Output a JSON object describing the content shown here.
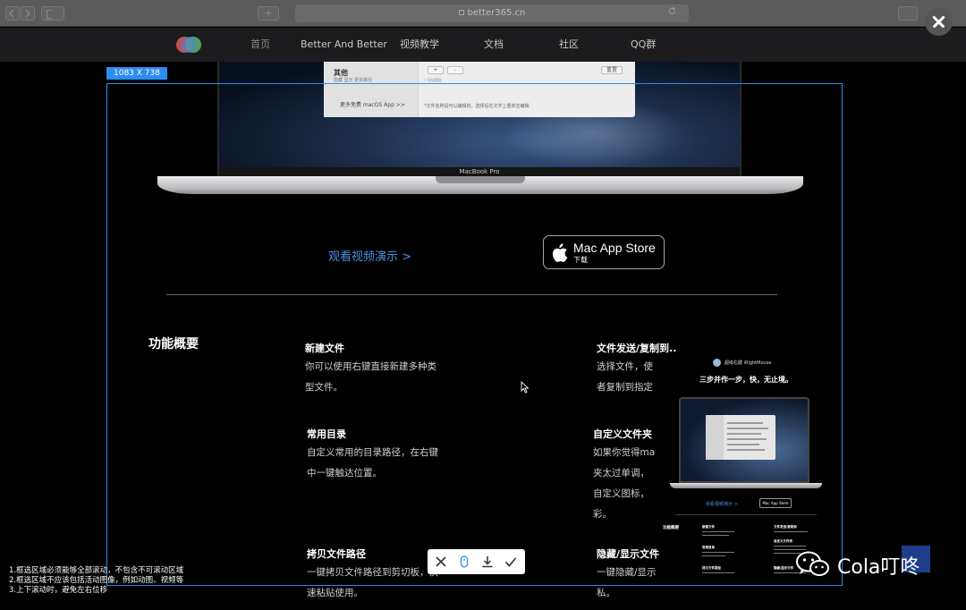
{
  "browser": {
    "url": "better365.cn",
    "back_icon": "chevron-left-icon",
    "forward_icon": "chevron-right-icon",
    "add_tab_label": "+"
  },
  "nav": {
    "items": [
      "首页",
      "Better And Better",
      "视频教学",
      "文档",
      "社区",
      "QQ群"
    ]
  },
  "settings_panel": {
    "section_label": "其他",
    "section_sub": "隐藏 显示 更多路径",
    "more_apps": "更多免费 macOS App >>",
    "note": "*文件名称是可以编辑的，选择后在文字上重单击编辑",
    "hint": "• 添加模版",
    "buttons": [
      "+",
      "-"
    ],
    "reset_label": "重置"
  },
  "laptop": {
    "label": "MacBook Pro"
  },
  "cta": {
    "watch_video": "观看视频演示 >",
    "appstore_main": "Mac App Store",
    "appstore_sub": "下载"
  },
  "features": {
    "section_title": "功能概要",
    "items": [
      {
        "title": "新建文件",
        "lines": [
          "你可以使用右键直接新建多种类",
          "型文件。"
        ]
      },
      {
        "title": "文件发送/复制到..",
        "lines": [
          "选择文件，使",
          "者复制到指定"
        ]
      },
      {
        "title": "常用目录",
        "lines": [
          "自定义常用的目录路径，在右键",
          "中一键触达位置。"
        ]
      },
      {
        "title": "自定义文件夹",
        "lines": [
          "如果你觉得ma",
          "夹太过单调，",
          "自定义图标，",
          "彩。"
        ]
      },
      {
        "title": "拷贝文件路径",
        "lines": [
          "一键拷贝文件路径到剪切板，快",
          "速粘贴使用。"
        ]
      },
      {
        "title": "隐藏/显示文件",
        "lines": [
          "一键隐藏/显示",
          "私。"
        ]
      }
    ]
  },
  "capture": {
    "size_label": "1083  X  738",
    "instructions": [
      "1.框选区域必须能够全部滚动，不包含不可滚动区域",
      "2.框选区域不应该包括活动图像，例如动图、视频等",
      "3.上下滚动时，避免左右位移"
    ],
    "tools": [
      "close-icon",
      "scroll-capture-icon",
      "download-icon",
      "check-icon"
    ]
  },
  "preview": {
    "app_name": "超级右键 iRightMouse",
    "slogan": "三步并作一步，快，无止境。",
    "watch_video": "观看视频演示 >",
    "appstore": "Mac App Store",
    "section_title": "功能概要",
    "feat_titles": [
      "新建文件",
      "文件发送/复制到",
      "常用目录",
      "自定义文件夹",
      "拷贝文件路径",
      "隐藏/显示文件"
    ]
  },
  "watermark": {
    "text": "Cola叮咚",
    "icon": "wechat-icon"
  },
  "colors": {
    "accent": "#2d8cf0",
    "link": "#4a90e2",
    "nav_bg": "#1c1c1e"
  }
}
